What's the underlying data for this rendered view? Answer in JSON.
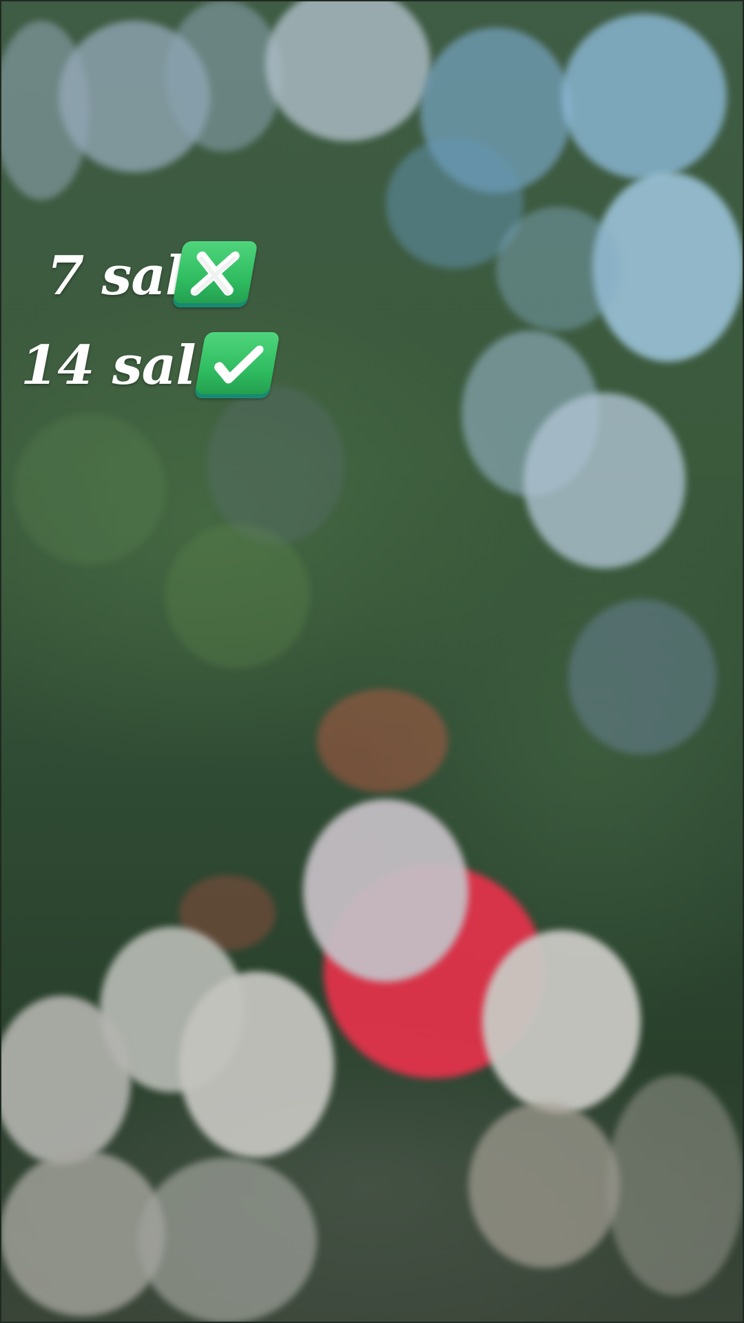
{
  "caption": {
    "line1": {
      "text": "7 sal",
      "emoji": "cross-mark-button-icon"
    },
    "line2": {
      "text": "14 sal",
      "emoji": "check-mark-button-icon"
    }
  },
  "background": {
    "description_colors": {
      "foliage": "#3b5a3c",
      "bokeh_blue": "#9fc0d8",
      "bokeh_white": "#d2d2d0",
      "bokeh_red": "#e8334a"
    }
  },
  "emoji_color": "#2fbb60"
}
